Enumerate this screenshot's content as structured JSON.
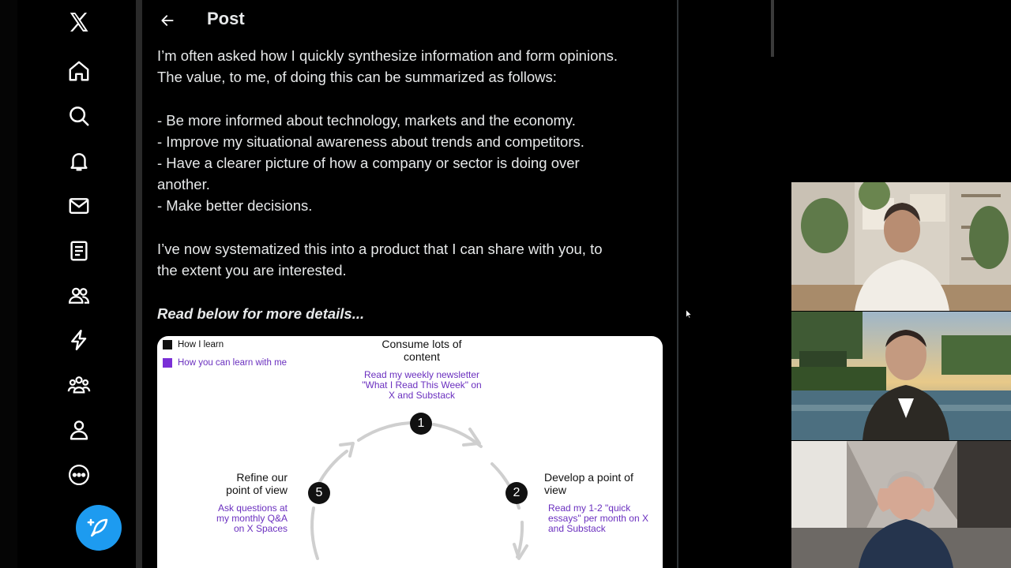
{
  "nav": {
    "items": [
      {
        "name": "x-logo-icon",
        "label": "X"
      },
      {
        "name": "home-icon",
        "label": "Home"
      },
      {
        "name": "search-icon",
        "label": "Explore"
      },
      {
        "name": "bell-icon",
        "label": "Notifications"
      },
      {
        "name": "mail-icon",
        "label": "Messages"
      },
      {
        "name": "list-icon",
        "label": "Lists"
      },
      {
        "name": "communities-icon",
        "label": "Communities"
      },
      {
        "name": "lightning-icon",
        "label": "Premium"
      },
      {
        "name": "people-icon",
        "label": "Verified Orgs"
      },
      {
        "name": "profile-icon",
        "label": "Profile"
      },
      {
        "name": "more-icon",
        "label": "More"
      }
    ],
    "compose_icon": "feather-plus-icon"
  },
  "header": {
    "title": "Post",
    "back_icon": "arrow-left-icon"
  },
  "post": {
    "para1_line1": "I’m often asked how I quickly synthesize information and form opinions.",
    "para1_line2": "The value, to me, of doing this can be summarized as follows:",
    "bullet1": "- Be more informed about technology, markets and the economy.",
    "bullet2": "- Improve my situational awareness about trends and competitors.",
    "bullet3_line1": "- Have a clearer picture of how a company or sector is doing over",
    "bullet3_line2": "another.",
    "bullet4": "- Make better decisions.",
    "para2_line1": "I’ve now systematized this into a product that I can share with you, to",
    "para2_line2": "the extent you are interested.",
    "emphasis": "Read below for more details..."
  },
  "diagram": {
    "legend": [
      {
        "label": "How I learn",
        "color": "#111111"
      },
      {
        "label": "How you can learn with me",
        "color": "#7a2fd6"
      }
    ],
    "steps": [
      {
        "num": "1",
        "head_l1": "Consume lots of",
        "head_l2": "content",
        "sub_l1": "Read my weekly newsletter",
        "sub_l2": "\"What I Read This Week\" on",
        "sub_l3": "X and Substack"
      },
      {
        "num": "2",
        "head_l1": "Develop a point of",
        "head_l2": "view",
        "sub_l1": "Read my 1-2 \"quick",
        "sub_l2": "essays\" per month on X",
        "sub_l3": "and Substack"
      },
      {
        "num": "5",
        "head_l1": "Refine our",
        "head_l2": "point of view",
        "sub_l1": "Ask questions at",
        "sub_l2": "my monthly Q&A",
        "sub_l3": "on X Spaces"
      }
    ],
    "accent": "#6a2fbf"
  },
  "video": {
    "participants": [
      {
        "name": "participant-1"
      },
      {
        "name": "participant-2"
      },
      {
        "name": "participant-3"
      }
    ]
  },
  "colors": {
    "brand": "#1d9bf0",
    "background": "#000000",
    "text": "#e7e9ea"
  }
}
